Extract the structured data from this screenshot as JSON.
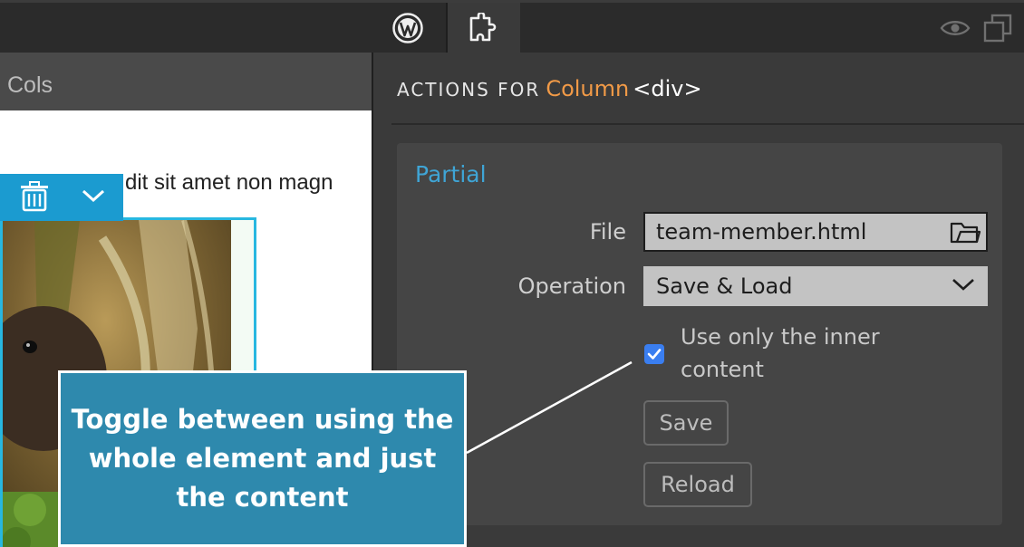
{
  "toolbar": {
    "icons": [
      "wordpress-icon",
      "puzzle-plugin-icon",
      "eye-icon",
      "duplicate-icon"
    ]
  },
  "canvas": {
    "header_label": "Cols",
    "body_text": "dit sit amet non magn",
    "element_toolbar_icons": [
      "trash-icon",
      "chevron-down-icon"
    ]
  },
  "panel": {
    "title_prefix": "ACTIONS FOR",
    "element_name": "Column",
    "element_tag": "<div>",
    "section_title": "Partial",
    "file_label": "File",
    "file_value": "team-member.html",
    "operation_label": "Operation",
    "operation_value": "Save & Load",
    "inner_content_label": "Use only the inner content",
    "inner_content_checked": true,
    "save_label": "Save",
    "reload_label": "Reload"
  },
  "tooltip": {
    "text": "Toggle between using the whole element and just the content"
  },
  "colors": {
    "accent_blue": "#3fa5d6",
    "element_orange": "#f19a47",
    "tooltip_bg": "#2e89ad",
    "selection_cyan": "#27b7e0",
    "checkbox_blue": "#3a7ef0"
  }
}
